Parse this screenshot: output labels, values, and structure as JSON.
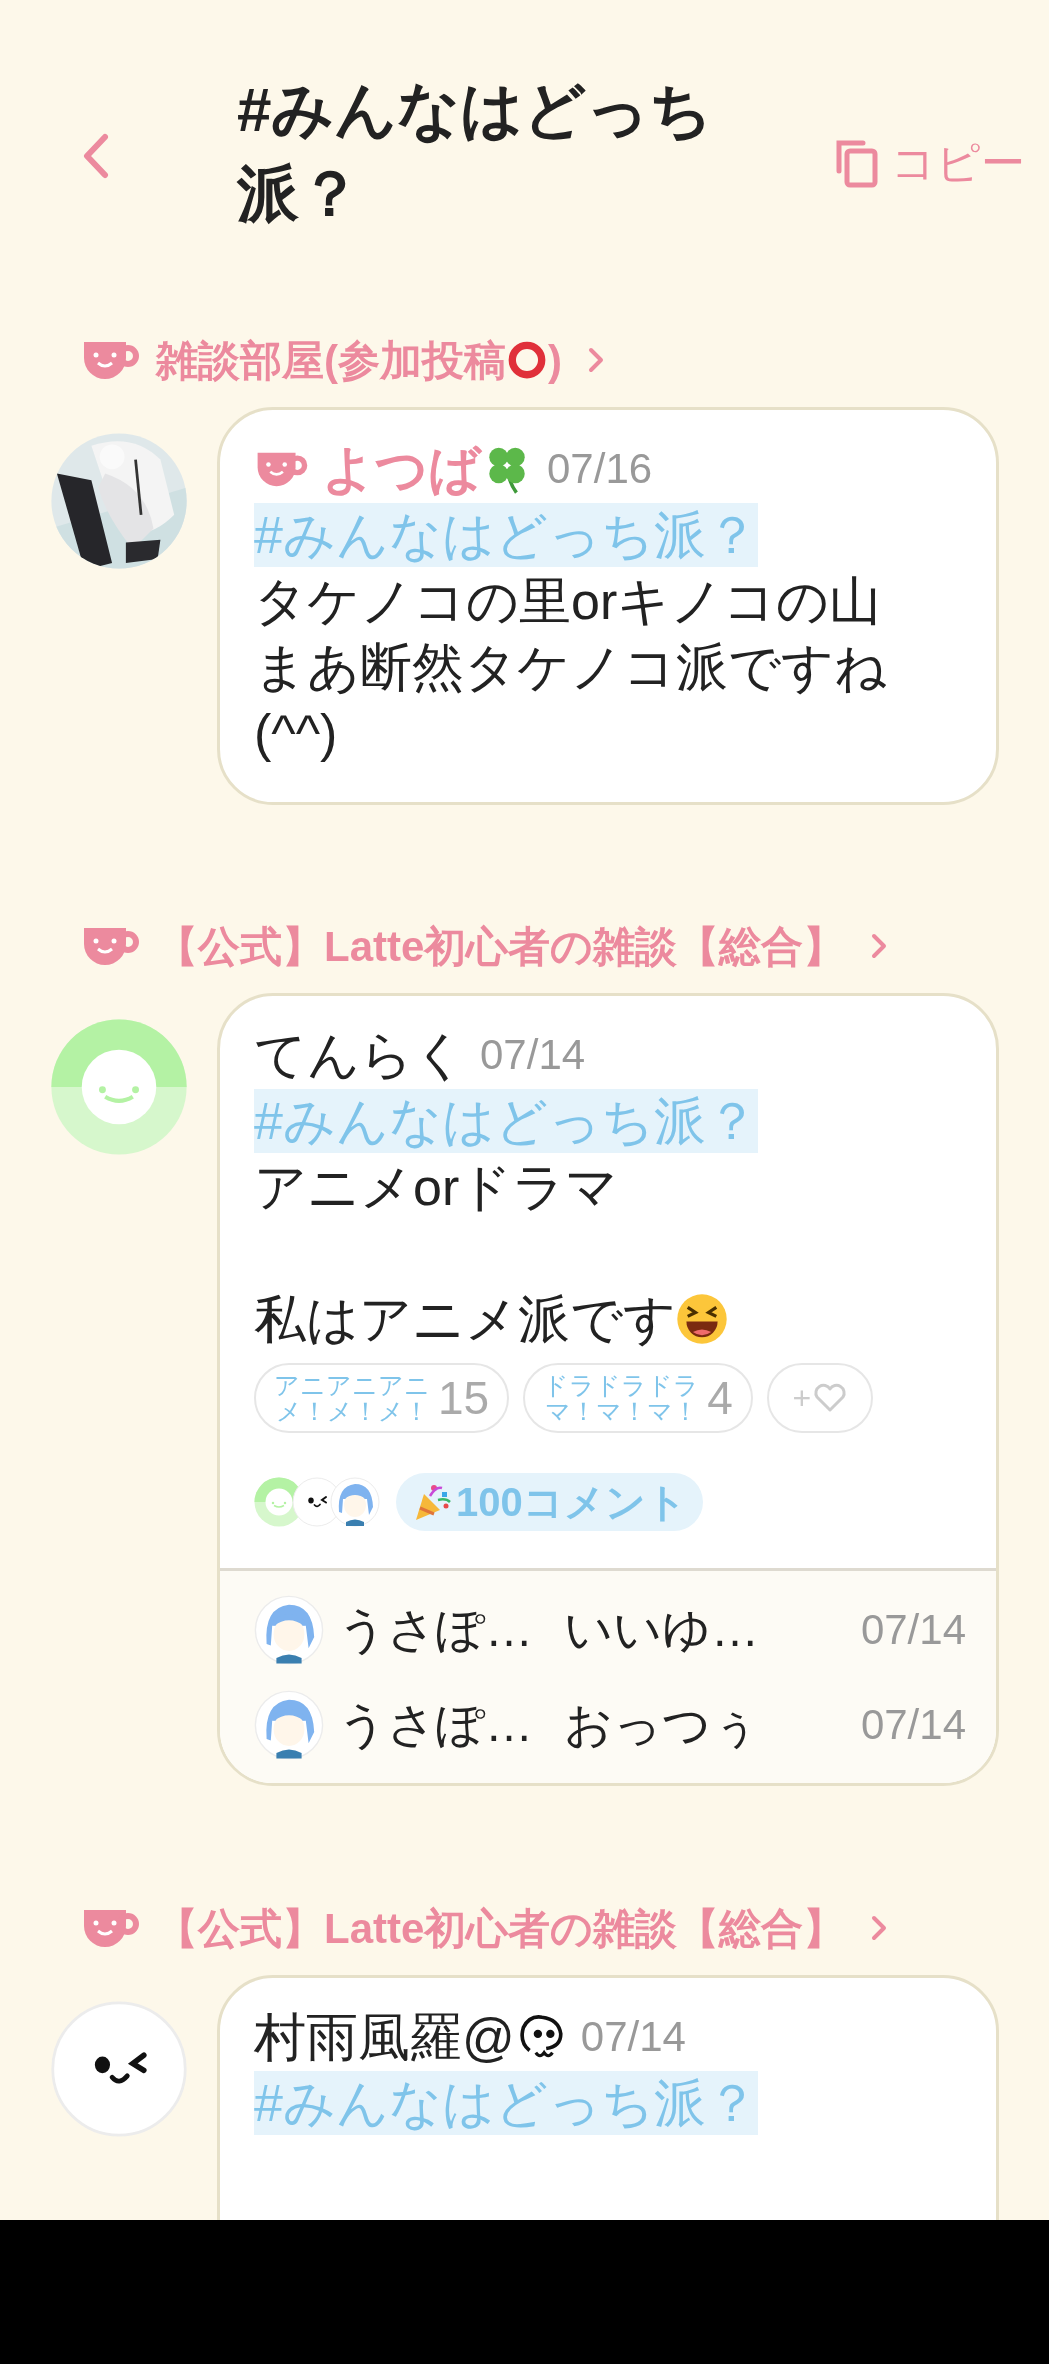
{
  "header": {
    "title": "#みんなはどっち派？",
    "copy_label": "コピー"
  },
  "posts": [
    {
      "room": [
        {
          "kind": "text",
          "text": "雑談部屋(参加投稿"
        },
        {
          "kind": "ring"
        },
        {
          "kind": "text",
          "text": ")"
        }
      ],
      "avatar": {
        "kind": "picture"
      },
      "owner": true,
      "author": [
        {
          "kind": "text",
          "text": "よつば"
        },
        {
          "kind": "clover"
        }
      ],
      "date": "07/16",
      "hashtag": "#みんなはどっち派？",
      "paragraphs": [
        {
          "lines": [
            [
              {
                "kind": "text",
                "text": "タケノコの里orキノコの山"
              }
            ],
            [
              {
                "kind": "text",
                "text": "まあ断然タケノコ派ですね"
              }
            ],
            [
              {
                "kind": "text",
                "text": "(^^)"
              }
            ]
          ]
        }
      ]
    },
    {
      "room": [
        {
          "kind": "text",
          "text": "【公式】Latte初心者の雑談【総合】"
        }
      ],
      "avatar": {
        "kind": "green"
      },
      "owner": false,
      "author": [
        {
          "kind": "text",
          "text": "てんらく"
        }
      ],
      "date": "07/14",
      "hashtag": "#みんなはどっち派？",
      "paragraphs": [
        {
          "lines": [
            [
              {
                "kind": "text",
                "text": "アニメorドラマ"
              }
            ]
          ]
        },
        {
          "lines": [
            [
              {
                "kind": "text",
                "text": "私はアニメ派です"
              },
              {
                "kind": "laugh"
              }
            ]
          ]
        }
      ],
      "reactions": [
        {
          "label_lines": [
            "アニアニアニ",
            "メ！メ！メ！"
          ],
          "count": "15"
        },
        {
          "label_lines": [
            "ドラドラドラ",
            "マ！マ！マ！"
          ],
          "count": "4"
        }
      ],
      "add_reaction": {
        "label": "+"
      },
      "commenters": [
        {
          "kind": "green"
        },
        {
          "kind": "wink"
        },
        {
          "kind": "girl"
        }
      ],
      "comment_count": "100コメント",
      "comments": [
        {
          "avatar": {
            "kind": "girl"
          },
          "author": "うさぽ…",
          "text": "いいゆ…",
          "date": "07/14"
        },
        {
          "avatar": {
            "kind": "girl"
          },
          "author": "うさぽ…",
          "text": "おっつぅ",
          "date": "07/14"
        }
      ]
    },
    {
      "room": [
        {
          "kind": "text",
          "text": "【公式】Latte初心者の雑談【総合】"
        }
      ],
      "avatar": {
        "kind": "wink"
      },
      "owner": false,
      "author": [
        {
          "kind": "text",
          "text": "村雨風羅@"
        },
        {
          "kind": "face-symbol"
        }
      ],
      "date": "07/14",
      "hashtag": "#みんなはどっち派？"
    }
  ]
}
